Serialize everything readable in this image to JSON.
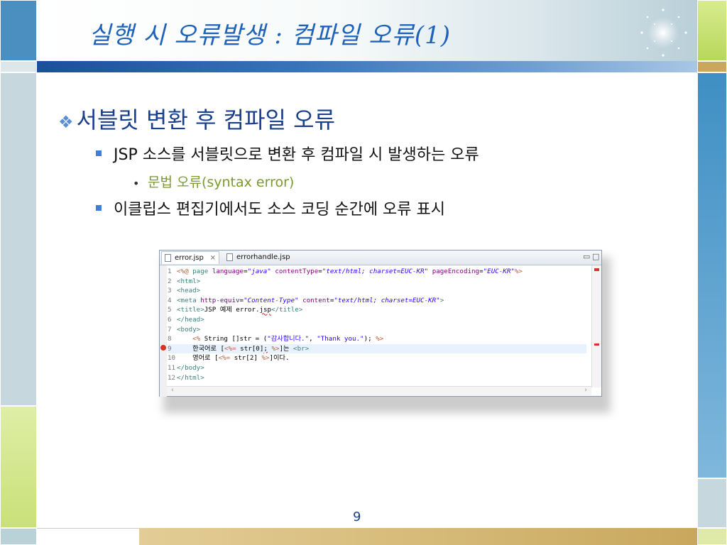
{
  "slide": {
    "title": "실행 시 오류발생 : 컴파일 오류(1)",
    "heading": "서블릿 변환 후 컴파일 오류",
    "heading_bullet": "❖",
    "bullets": [
      "JSP 소스를 서블릿으로 변환 후 컴파일 시 발생하는 오류",
      "이클립스 편집기에서도 소스 코딩 순간에 오류 표시"
    ],
    "sub_bullet": "문법 오류(syntax error)",
    "page_number": "9"
  },
  "editor": {
    "tabs": [
      {
        "label": "error.jsp",
        "active": true
      },
      {
        "label": "errorhandle.jsp",
        "active": false
      }
    ],
    "window_controls": [
      "minimize-icon",
      "maximize-icon"
    ],
    "error_line": 9,
    "lines": [
      "1",
      "2",
      "3",
      "4",
      "5",
      "6",
      "7",
      "8",
      "9",
      "10",
      "11",
      "12"
    ],
    "code": {
      "l1_pre": "<%@ ",
      "l1_page": "page ",
      "l1_a1": "language",
      "l1_v1": "\"java\"",
      "l1_a2": "contentType",
      "l1_v2": "\"text/html; charset=EUC-KR\"",
      "l1_a3": "pageEncoding",
      "l1_v3": "\"EUC-KR\"",
      "l1_end": "%>",
      "l2": "<html>",
      "l3": "<head>",
      "l4_tag": "<meta ",
      "l4_a1": "http-equiv",
      "l4_v1": "\"Content-Type\"",
      "l4_a2": "content",
      "l4_v2": "\"text/html; charset=EUC-KR\"",
      "l4_end": ">",
      "l5_open": "<title>",
      "l5_text_a": "JSP 예제 error.",
      "l5_text_b": "jsp",
      "l5_close": "</title>",
      "l6": "</head>",
      "l7": "<body>",
      "l8_open": "<%",
      "l8_code": " String []str = (",
      "l8_s1": "\"감사합니다.\"",
      "l8_mid": ", ",
      "l8_s2": "\"Thank you.\"",
      "l8_tail": "); ",
      "l8_close": "%>",
      "l9_text": "한국어로 [",
      "l9_expr_open": "<%=",
      "l9_expr": " str[0]",
      "l9_semi": ";",
      "l9_expr_close": " %>",
      "l9_after": "]는 ",
      "l9_br": "<br>",
      "l10_text": "영어로 [",
      "l10_expr_open": "<%=",
      "l10_expr": " str[2] ",
      "l10_expr_close": "%>",
      "l10_after": "]이다.",
      "l11": "</body>",
      "l12": "</html>"
    }
  }
}
